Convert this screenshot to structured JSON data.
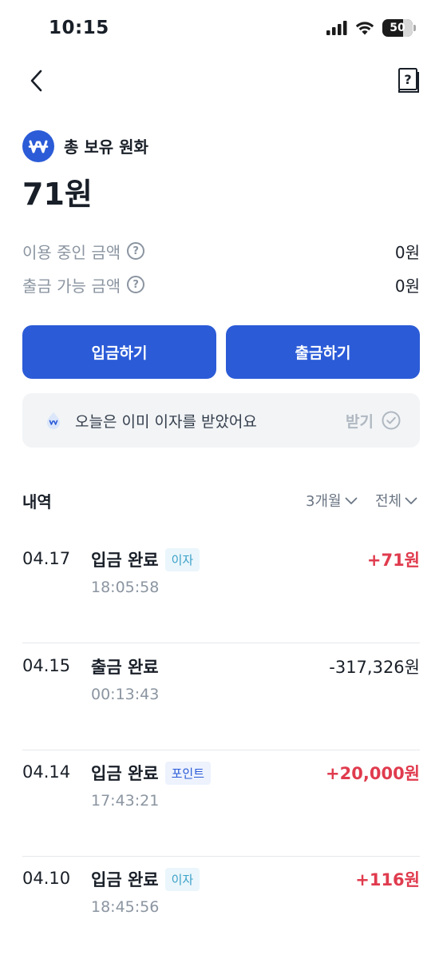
{
  "status_bar": {
    "time": "10:15",
    "battery": "50",
    "icons": [
      "signal-icon",
      "wifi-icon",
      "battery-icon"
    ]
  },
  "nav": {
    "back_icon": "chevron-left-icon",
    "help_icon": "question-book-icon"
  },
  "account": {
    "logo_icon": "won-icon",
    "title": "총 보유 원화",
    "total": "71원",
    "in_use_label": "이용 중인 금액",
    "in_use_value": "0원",
    "withdrawable_label": "출금 가능 금액",
    "withdrawable_value": "0원",
    "help_glyph": "?"
  },
  "actions": {
    "deposit": "입금하기",
    "withdraw": "출금하기"
  },
  "interest_banner": {
    "text": "오늘은 이미 이자를 받았어요",
    "receive_label": "받기"
  },
  "history": {
    "title": "내역",
    "period_filter": "3개월",
    "type_filter": "전체",
    "transactions": [
      {
        "date": "04.17",
        "status": "입금 완료",
        "tag": "이자",
        "time": "18:05:58",
        "amount": "+71원"
      },
      {
        "date": "04.15",
        "status": "출금 완료",
        "tag": "",
        "time": "00:13:43",
        "amount": "-317,326원"
      },
      {
        "date": "04.14",
        "status": "입금 완료",
        "tag": "포인트",
        "time": "17:43:21",
        "amount": "+20,000원"
      },
      {
        "date": "04.10",
        "status": "입금 완료",
        "tag": "이자",
        "time": "18:45:56",
        "amount": "+116원"
      }
    ]
  },
  "colors": {
    "primary": "#2b5bd7",
    "plus_amount": "#e03b4e",
    "muted_text": "#8b95a1",
    "banner_bg": "#f2f4f6"
  }
}
